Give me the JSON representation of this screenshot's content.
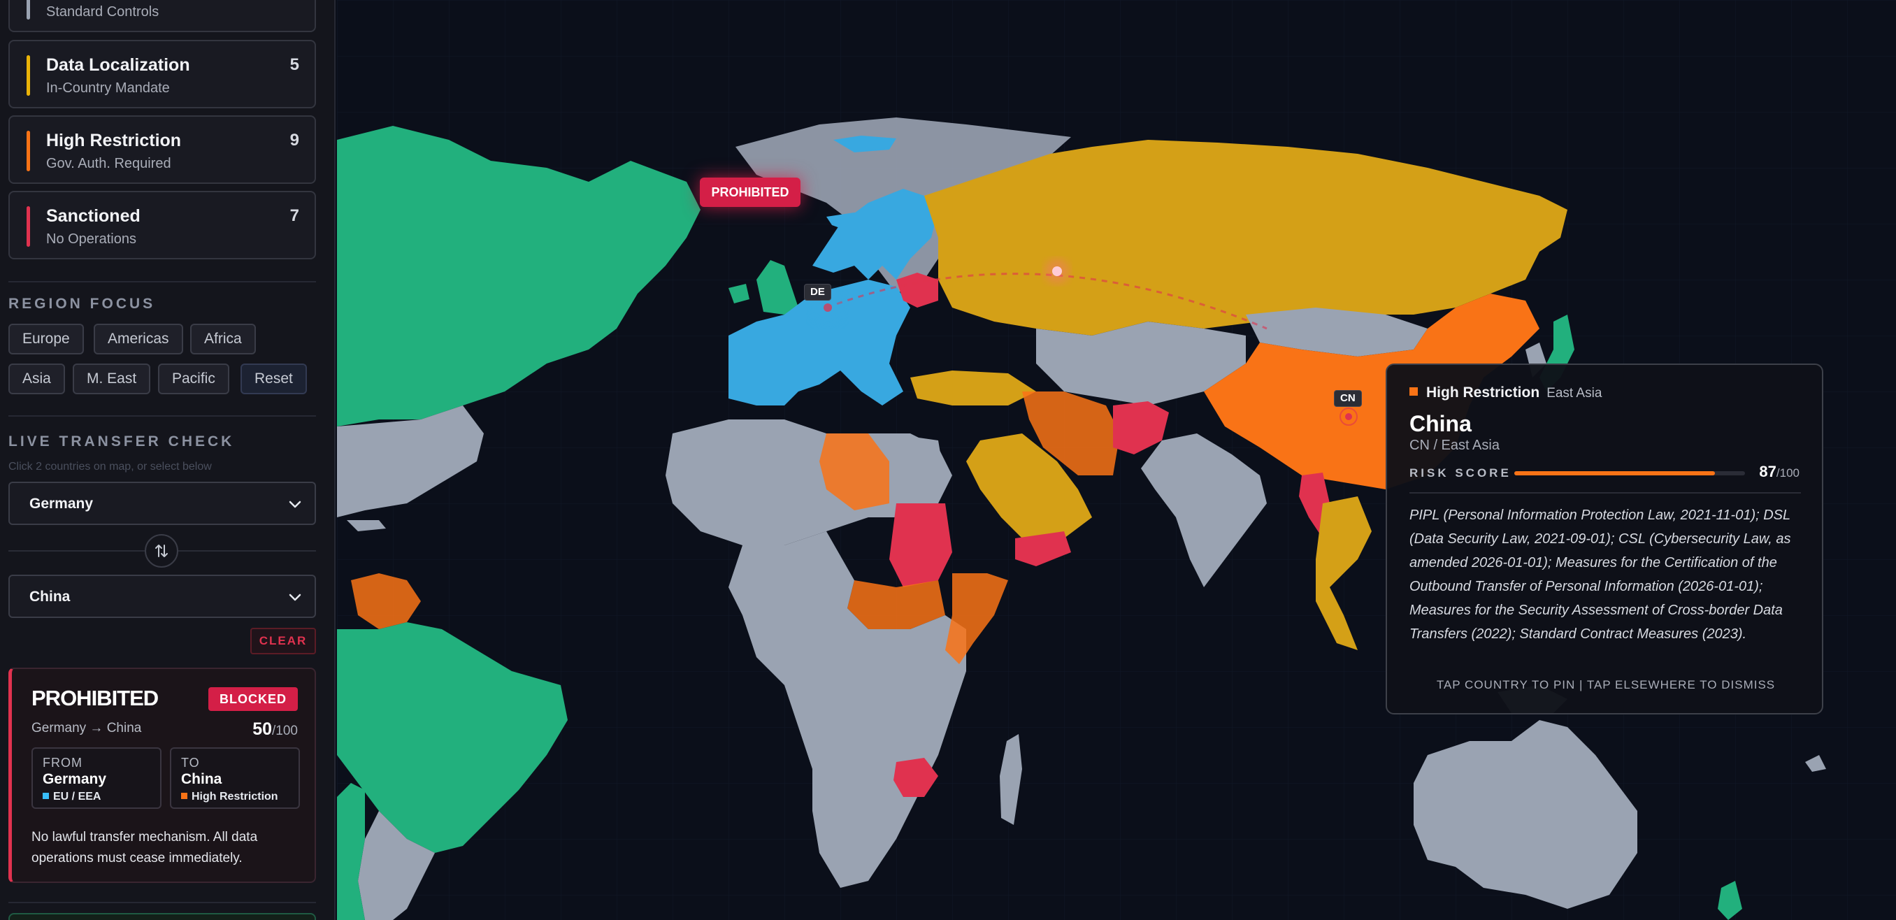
{
  "tiers": [
    {
      "title": "",
      "subtitle": "Standard Controls",
      "count": "",
      "color": "#9aa3b2"
    },
    {
      "title": "Data Localization",
      "subtitle": "In-Country Mandate",
      "count": "5",
      "color": "#eab308"
    },
    {
      "title": "High Restriction",
      "subtitle": "Gov. Auth. Required",
      "count": "9",
      "color": "#f97316"
    },
    {
      "title": "Sanctioned",
      "subtitle": "No Operations",
      "count": "7",
      "color": "#e0324f"
    }
  ],
  "region_focus": {
    "label": "REGION FOCUS",
    "chips": [
      "Europe",
      "Americas",
      "Africa",
      "Asia",
      "M. East",
      "Pacific"
    ],
    "reset": "Reset"
  },
  "transfer": {
    "label": "LIVE TRANSFER CHECK",
    "hint": "Click 2 countries on map, or select below",
    "from_value": "Germany",
    "to_value": "China",
    "clear": "CLEAR"
  },
  "result": {
    "verdict": "PROHIBITED",
    "badge": "BLOCKED",
    "route": "Germany → China",
    "score": "50",
    "score_max": "/100",
    "from_caption": "FROM",
    "from_name": "Germany",
    "from_tag": "EU / EEA",
    "from_color": "#38bdf8",
    "to_caption": "TO",
    "to_name": "China",
    "to_tag": "High Restriction",
    "to_color": "#f97316",
    "note": "No lawful transfer mechanism. All data operations must cease immediately."
  },
  "map": {
    "markers": {
      "de": "DE",
      "cn": "CN"
    },
    "prohibited_label": "PROHIBITED",
    "colors": {
      "standard": "#9aa3b2",
      "localization": "#d4a017",
      "high": "#f97316",
      "sanctioned": "#e0324f",
      "eu": "#38a8e0",
      "adequate": "#22b07d"
    }
  },
  "tooltip": {
    "tier": "High Restriction",
    "region": "East Asia",
    "country": "China",
    "code": "CN / East Asia",
    "risk_label": "RISK SCORE",
    "risk_score": 87,
    "risk_score_text": "87",
    "risk_max": "/100",
    "laws": "PIPL (Personal Information Protection Law, 2021-11-01); DSL (Data Security Law, 2021-09-01); CSL (Cybersecurity Law, as amended 2026-01-01); Measures for the Certification of the Outbound Transfer of Personal Information (2026-01-01); Measures for the Security Assessment of Cross-border Data Transfers (2022); Standard Contract Measures (2023).",
    "hint": "TAP COUNTRY TO PIN | TAP ELSEWHERE TO DISMISS"
  }
}
